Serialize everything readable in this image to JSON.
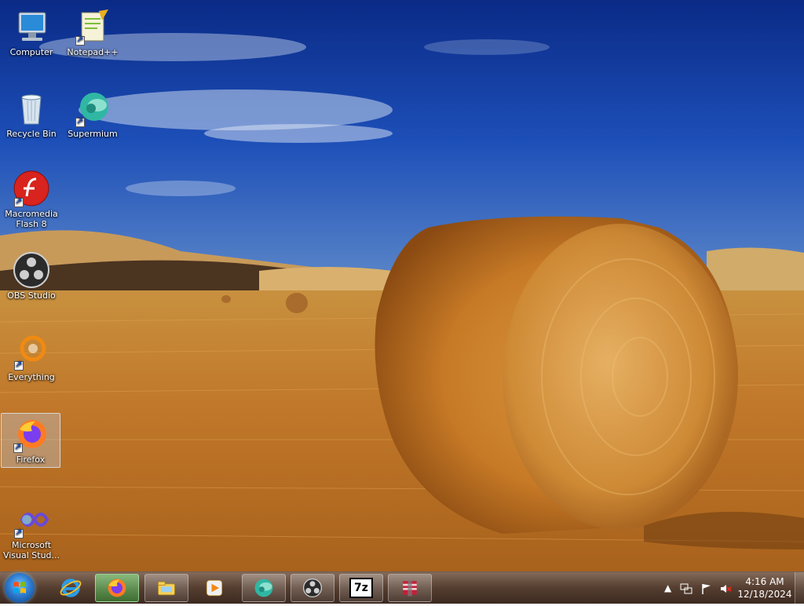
{
  "desktop": {
    "icons": [
      {
        "label": "Computer",
        "icon": "computer-icon"
      },
      {
        "label": "Notepad++",
        "icon": "notepadpp-icon"
      },
      {
        "label": "Recycle Bin",
        "icon": "recycle-bin-icon"
      },
      {
        "label": "Supermium",
        "icon": "supermium-icon"
      },
      {
        "label": "Macromedia Flash 8",
        "icon": "flash-icon"
      },
      {
        "label": "OBS Studio",
        "icon": "obs-icon"
      },
      {
        "label": "Everything",
        "icon": "everything-icon"
      },
      {
        "label": "Firefox",
        "icon": "firefox-icon"
      },
      {
        "label": "Microsoft Visual Stud...",
        "icon": "visual-studio-icon"
      }
    ]
  },
  "taskbar": {
    "start": "start-orb",
    "pinned": [
      {
        "name": "Internet Explorer",
        "icon": "ie-icon"
      },
      {
        "name": "Firefox",
        "icon": "firefox-icon"
      },
      {
        "name": "Windows Explorer",
        "icon": "explorer-icon"
      },
      {
        "name": "Windows Media Player",
        "icon": "media-player-icon"
      },
      {
        "name": "Supermium",
        "icon": "supermium-icon"
      },
      {
        "name": "OBS Studio",
        "icon": "obs-icon"
      },
      {
        "name": "7-Zip",
        "icon": "7zip-icon",
        "text": "7z"
      },
      {
        "name": "WinRAR",
        "icon": "winrar-icon"
      }
    ],
    "tray": {
      "time": "4:16 AM",
      "date": "12/18/2024"
    }
  }
}
